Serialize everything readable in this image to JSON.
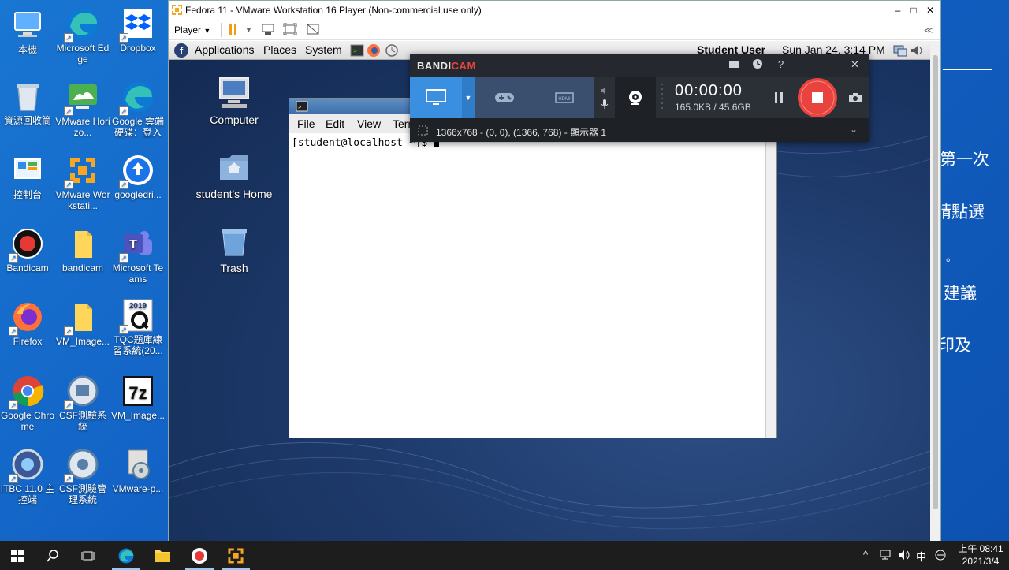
{
  "desktop": {
    "icons": [
      {
        "label": "本機"
      },
      {
        "label": "Microsoft Edge"
      },
      {
        "label": "Dropbox"
      },
      {
        "label": "資源回收筒"
      },
      {
        "label": "VMware Horizo..."
      },
      {
        "label": "Google 雲端硬碟：登入"
      },
      {
        "label": "控制台"
      },
      {
        "label": "VMware Workstati..."
      },
      {
        "label": "googledri..."
      },
      {
        "label": "Bandicam"
      },
      {
        "label": "bandicam"
      },
      {
        "label": "Microsoft Teams"
      },
      {
        "label": "Firefox"
      },
      {
        "label": "VM_Image..."
      },
      {
        "label": "TQC題庫練習系統(20..."
      },
      {
        "label": "Google Chrome"
      },
      {
        "label": "CSF測驗系統"
      },
      {
        "label": "VM_Image..."
      },
      {
        "label": "ITBC 11.0 主控端"
      },
      {
        "label": "CSF測驗管理系統"
      },
      {
        "label": "VMware-p..."
      }
    ],
    "background_text": [
      "第一次",
      "請點選",
      "。",
      "建議",
      "印及"
    ]
  },
  "vmware": {
    "title": "Fedora 11 - VMware Workstation 16 Player (Non-commercial use only)",
    "player_menu": "Player",
    "controls": {
      "minimize": "–",
      "maximize": "□",
      "close": "✕"
    },
    "back_glyph": "≪"
  },
  "guest": {
    "panel": {
      "menus": [
        "Applications",
        "Places",
        "System"
      ],
      "user": "Student User",
      "datetime": "Sun Jan 24,  3:14 PM"
    },
    "icons": [
      {
        "label": "Computer"
      },
      {
        "label": "student's Home"
      },
      {
        "label": "Trash"
      }
    ],
    "terminal": {
      "menus": [
        "File",
        "Edit",
        "View",
        "Term"
      ],
      "prompt": "[student@localhost ~]$ "
    }
  },
  "bandicam": {
    "logo_a": "BANDI",
    "logo_b": "CAM",
    "timer": "00:00:00",
    "size": "165.0KB / 45.6GB",
    "region": "1366x768 - (0, 0), (1366, 768) - 顯示器 1",
    "hdmi_label": "HDMI",
    "help": "?",
    "min": "–",
    "close": "✕"
  },
  "taskbar": {
    "ime": "中",
    "time": "上午 08:41",
    "date": "2021/3/4"
  },
  "colors": {
    "desktop_blue": "#1565c0",
    "bandicam_accent": "#3b8fe0",
    "record_red": "#e8433e",
    "taskbar": "#1d1d1d"
  }
}
